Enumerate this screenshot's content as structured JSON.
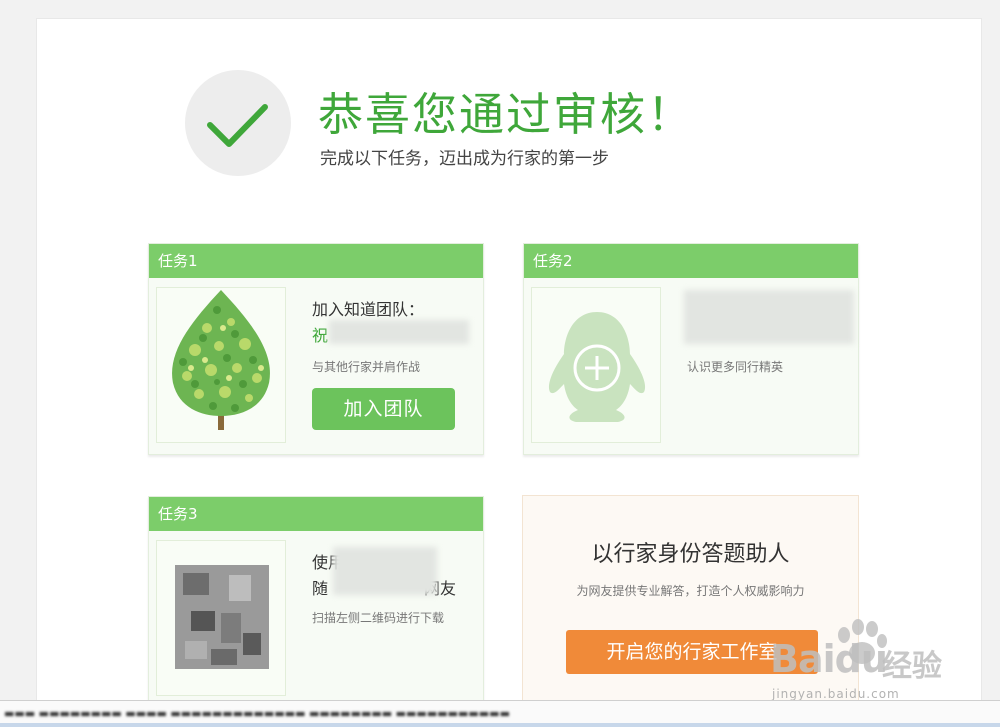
{
  "header": {
    "title": "恭喜您通过审核！",
    "subtitle": "完成以下任务，迈出成为行家的第一步"
  },
  "tasks": [
    {
      "label": "任务1",
      "line1": "加入知道团队：",
      "line2": "",
      "desc": "与其他行家并肩作战",
      "button": "加入团队"
    },
    {
      "label": "任务2",
      "line1": "",
      "line2": "",
      "desc": "认识更多同行精英"
    },
    {
      "label": "任务3",
      "line1": "使用",
      "line2": "网友",
      "desc": "扫描左侧二维码进行下载"
    }
  ],
  "promo": {
    "title": "以行家身份答题助人",
    "subtitle": "为网友提供专业解答，打造个人权威影响力",
    "button": "开启您的行家工作室"
  },
  "watermark": {
    "logo": "Baidu",
    "cn": "经验",
    "url": "jingyan.baidu.com"
  },
  "colors": {
    "accent_green": "#3fa73a",
    "card_header_green": "#7ccd6a",
    "button_green": "#6cc35c",
    "promo_orange": "#f08a39"
  }
}
